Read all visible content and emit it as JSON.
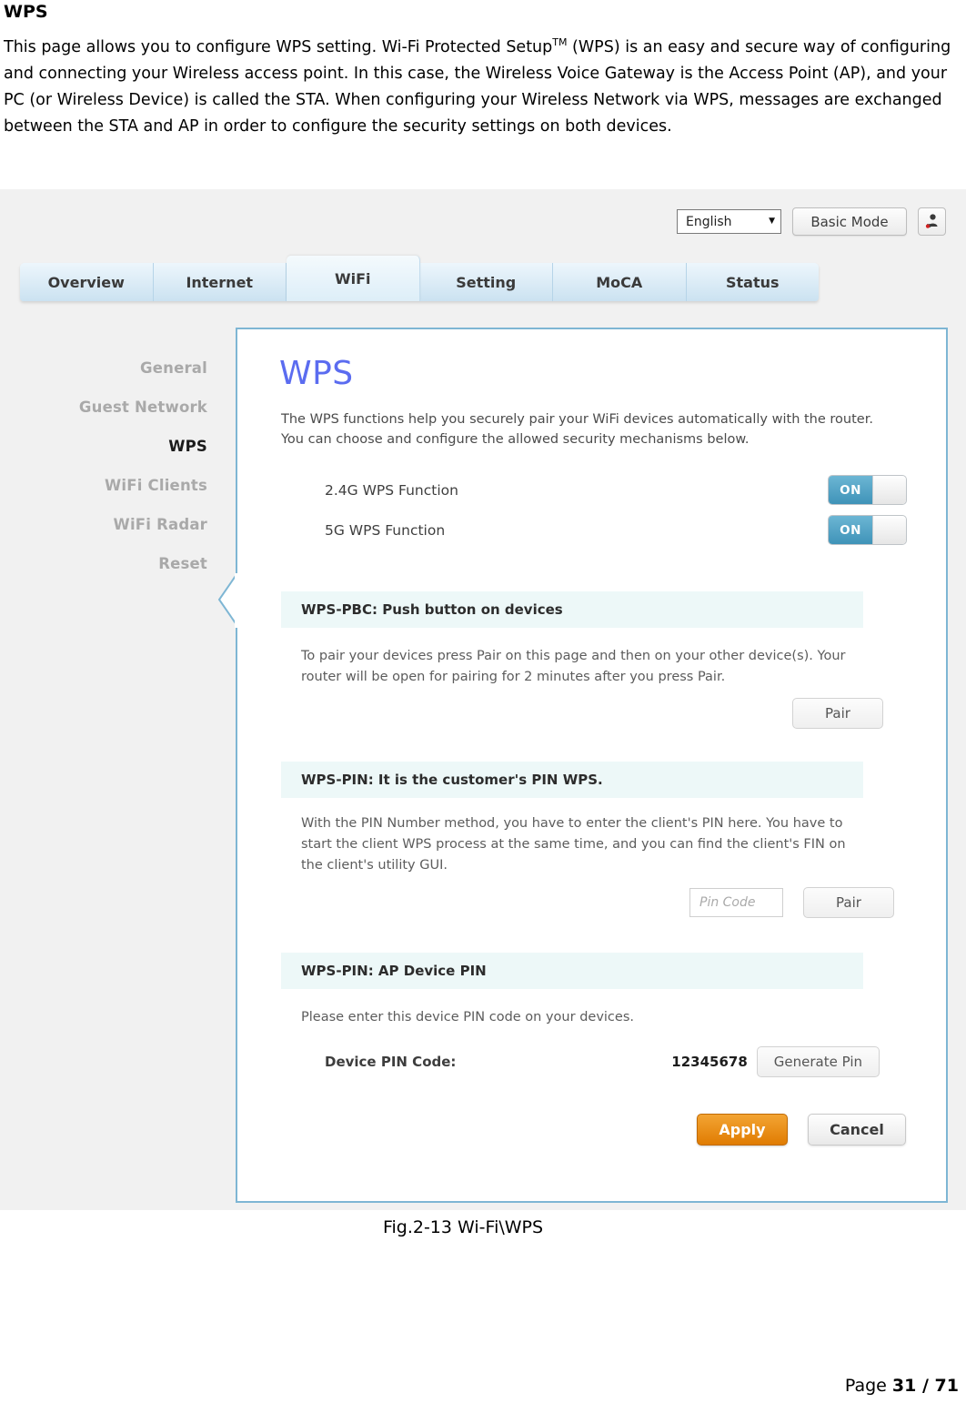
{
  "document": {
    "heading": "WPS",
    "paragraph_parts": {
      "p1": "This page allows you to configure WPS setting. Wi-Fi Protected Setup",
      "sup": "TM",
      "p2": " (WPS) is an easy and secure  way of configuring and connecting your Wireless access point. In this case, the Wireless Voice Gateway  is the Access Point (AP), and your PC (or Wireless Device) is called the STA. When configuring your  Wireless Network via WPS, messages are exchanged between the STA and AP in order to configure the  security settings on both devices."
    },
    "figure_caption": "Fig.2-13 Wi-Fi\\WPS",
    "footer": {
      "label": "Page ",
      "current": "31",
      "separator": " / ",
      "total": "71"
    }
  },
  "screenshot": {
    "topbar": {
      "language_value": "English",
      "language_caret": "▼",
      "basic_mode_label": "Basic Mode",
      "user_icon": "user-account-icon"
    },
    "nav_tabs": [
      {
        "label": "Overview",
        "active": false
      },
      {
        "label": "Internet",
        "active": false
      },
      {
        "label": "WiFi",
        "active": true
      },
      {
        "label": "Setting",
        "active": false
      },
      {
        "label": "MoCA",
        "active": false
      },
      {
        "label": "Status",
        "active": false
      }
    ],
    "sidebar": [
      {
        "label": "General",
        "active": false
      },
      {
        "label": "Guest Network",
        "active": false
      },
      {
        "label": "WPS",
        "active": true
      },
      {
        "label": "WiFi Clients",
        "active": false
      },
      {
        "label": "WiFi Radar",
        "active": false
      },
      {
        "label": "Reset",
        "active": false
      }
    ],
    "panel": {
      "title": "WPS",
      "title_color": "#5b6cf0",
      "description": "The WPS functions help you securely pair your WiFi devices automatically with the router. You can choose and configure the allowed security mechanisms below.",
      "toggles": [
        {
          "label": "2.4G WPS Function",
          "state": "ON"
        },
        {
          "label": "5G WPS Function",
          "state": "ON"
        }
      ],
      "section_pbc": {
        "header": "WPS-PBC: Push button on devices",
        "body": "To pair your devices press Pair on this page and then on your other device(s). Your router will be open for pairing for 2 minutes after you press Pair.",
        "pair_button": "Pair"
      },
      "section_pin_customer": {
        "header": "WPS-PIN: It is the customer's PIN WPS.",
        "body": "With the PIN Number method, you have to enter the client's PIN here. You have to start the client WPS process at the same time, and you can find the client's FIN on the client's utility GUI.",
        "pin_placeholder": "Pin Code",
        "pin_value": "",
        "pair_button": "Pair"
      },
      "section_pin_ap": {
        "header": "WPS-PIN: AP Device PIN",
        "body": "Please enter this device PIN code on your devices.",
        "pin_label": "Device PIN Code:",
        "pin_code": "12345678",
        "generate_button": "Generate Pin"
      },
      "actions": {
        "apply": "Apply",
        "cancel": "Cancel",
        "apply_color": "#e07c02"
      }
    }
  }
}
